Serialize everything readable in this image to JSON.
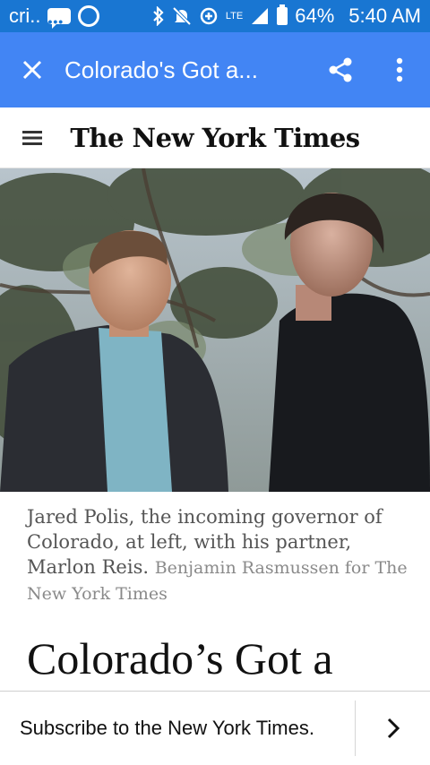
{
  "status_bar": {
    "carrier": "cri..",
    "network": "LTE",
    "battery": "64%",
    "time": "5:40 AM",
    "icons": [
      "message-icon",
      "sync-icon",
      "bluetooth-icon",
      "mute-icon",
      "data-saver-icon",
      "lte-icon",
      "signal-icon",
      "battery-icon"
    ]
  },
  "app_bar": {
    "title": "Colorado's Got a...",
    "close_icon": "close-icon",
    "share_icon": "share-icon",
    "more_icon": "more-vert-icon"
  },
  "masthead": {
    "menu_icon": "menu-icon",
    "logo": "The New York Times"
  },
  "article": {
    "photo_description": "photo",
    "caption": "Jared Polis, the incoming governor of Colorado, at left, with his partner, Marlon Reis.",
    "credit": "Benjamin Rasmussen for The New York Times",
    "headline": "Colorado’s Got a"
  },
  "subscribe": {
    "label": "Subscribe to the New York Times.",
    "chevron_icon": "chevron-right-icon"
  },
  "colors": {
    "status_bar": "#1976d2",
    "app_bar": "#4285f4"
  }
}
